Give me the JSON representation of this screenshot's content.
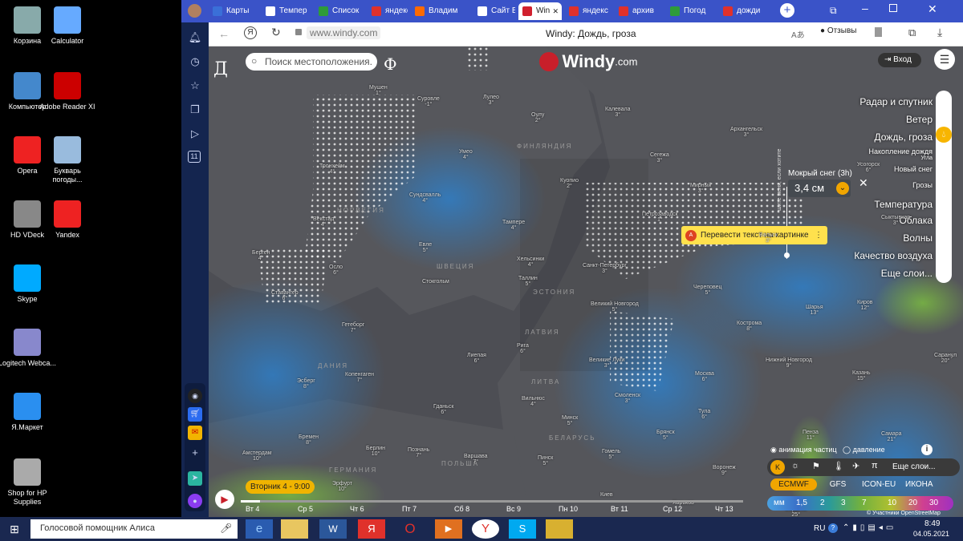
{
  "desktop": {
    "icons": [
      {
        "label": "Корзина",
        "icon": "recycle-bin-icon"
      },
      {
        "label": "Calculator",
        "icon": "calculator-icon"
      },
      {
        "label": "Компьютер",
        "icon": "computer-icon"
      },
      {
        "label": "Adobe Reader XI",
        "icon": "adobe-reader-icon"
      },
      {
        "label": "Opera",
        "icon": "opera-icon"
      },
      {
        "label": "Букварь погоды...",
        "icon": "document-icon"
      },
      {
        "label": "HD VDeck",
        "icon": "hd-vdeck-icon"
      },
      {
        "label": "Yandex",
        "icon": "yandex-browser-icon"
      },
      {
        "label": "Skype",
        "icon": "skype-icon"
      },
      {
        "label": "Logitech Webca...",
        "icon": "webcam-icon"
      },
      {
        "label": "Я.Маркет",
        "icon": "yandex-market-icon"
      },
      {
        "label": "Shop for HP Supplies",
        "icon": "hp-printer-icon"
      }
    ]
  },
  "tabs": [
    {
      "label": "Карты",
      "color": "#3a6fd8"
    },
    {
      "label": "Темпер",
      "color": "#ffffff"
    },
    {
      "label": "Список",
      "color": "#2e9b3a"
    },
    {
      "label": "яндекс",
      "color": "#e0312b"
    },
    {
      "label": "Владим",
      "color": "#ff6a00"
    },
    {
      "label": "Сайт В",
      "color": "#ffffff"
    },
    {
      "label": "Win",
      "color": "#d0202e",
      "active": true
    },
    {
      "label": "яндекс",
      "color": "#e0312b"
    },
    {
      "label": "архив",
      "color": "#e0312b"
    },
    {
      "label": "Погод",
      "color": "#2e9b3a"
    },
    {
      "label": "дожди",
      "color": "#e0312b"
    }
  ],
  "address": {
    "url": "www.windy.com",
    "title": "Windy: Дождь, гроза",
    "reviews": "Отзывы"
  },
  "windy": {
    "search_placeholder": "Поиск местоположения.",
    "logo_main": "Windy",
    "logo_domain": ".com",
    "login": "Вход",
    "letter_left": "Д",
    "letter_right": "Ф",
    "popup_title": "Мокрый снег (3h)",
    "popup_value": "3,4 см",
    "vertical_text": "шите меня, если хотите",
    "translate_text": "Перевести текст на картинке",
    "layers": [
      "Радар и спутник",
      "Ветер",
      "Дождь, гроза",
      "Накопление дождя",
      "Угла",
      "Новый снег",
      "Грозы",
      "Температура",
      "Облака",
      "Волны",
      "Качество воздуха",
      "Еще слои..."
    ],
    "time_label": "Вторник 4 - 9:00",
    "days": [
      "Вт 4",
      "Ср 5",
      "Чт 6",
      "Пт 7",
      "Сб 8",
      "Вс 9",
      "Пн 10",
      "Вт 11",
      "Ср 12",
      "Чт 13"
    ],
    "particles": "анимация частиц",
    "pressure": "давление",
    "more_layers": "Еще слои...",
    "models": [
      "ECMWF",
      "GFS",
      "ICON-EU",
      "ИКОНА"
    ],
    "scale_unit": "мм",
    "scale": [
      "1,5",
      "2",
      "3",
      "7",
      "10",
      "20",
      "30"
    ],
    "attribution": "© Участники OpenStreetMap"
  },
  "map_labels": {
    "cities": [
      {
        "t": "Мушен",
        "d": "1°"
      },
      {
        "t": "Суровле",
        "d": "-1°"
      },
      {
        "t": "Лулео",
        "d": "3°"
      },
      {
        "t": "Калевала",
        "d": "3°"
      },
      {
        "t": "Оулу",
        "d": "2°"
      },
      {
        "t": "Архангельск",
        "d": "3°"
      },
      {
        "t": "Умео",
        "d": "4°"
      },
      {
        "t": "Сегежа",
        "d": "3°"
      },
      {
        "t": "Усогорск",
        "d": "6°"
      },
      {
        "t": "Тронхейм",
        "d": "4°"
      },
      {
        "t": "Куопио",
        "d": "2°"
      },
      {
        "t": "Мирный",
        "d": "3°"
      },
      {
        "t": "Сундсвалль",
        "d": "4°"
      },
      {
        "t": "Петрозаводск",
        "d": "1°"
      },
      {
        "t": "Сыктывкар",
        "d": "3°"
      },
      {
        "t": "Векстад",
        "d": "4°"
      },
      {
        "t": "Тампере",
        "d": "4°"
      },
      {
        "t": "Вальск",
        "d": "3°"
      },
      {
        "t": "Берген",
        "d": "4°"
      },
      {
        "t": "Евле",
        "d": "5°"
      },
      {
        "t": "Хельсинки",
        "d": "4°"
      },
      {
        "t": "Санкт-Петербург",
        "d": "3°"
      },
      {
        "t": "Осло",
        "d": "6°"
      },
      {
        "t": "Стокгольм",
        "d": ""
      },
      {
        "t": "Таллин",
        "d": "5°"
      },
      {
        "t": "Череповец",
        "d": "5°"
      },
      {
        "t": "Ставангер",
        "d": "6°"
      },
      {
        "t": "Великий Новгород",
        "d": "5°"
      },
      {
        "t": "Шарья",
        "d": "13°"
      },
      {
        "t": "Киров",
        "d": "12°"
      },
      {
        "t": "Гетеборг",
        "d": "7°"
      },
      {
        "t": "Кострома",
        "d": "8°"
      },
      {
        "t": "Рига",
        "d": "6°"
      },
      {
        "t": "Лиепая",
        "d": "6°"
      },
      {
        "t": "Великие Луки",
        "d": "3°"
      },
      {
        "t": "Нижний Новгород",
        "d": "9°"
      },
      {
        "t": "Саранул",
        "d": "20°"
      },
      {
        "t": "Эсберг",
        "d": "8°"
      },
      {
        "t": "Копенгаген",
        "d": "7°"
      },
      {
        "t": "Москва",
        "d": "6°"
      },
      {
        "t": "Казань",
        "d": "15°"
      },
      {
        "t": "Вильнюс",
        "d": "4°"
      },
      {
        "t": "Гданьск",
        "d": "6°"
      },
      {
        "t": "Смоленск",
        "d": "3°"
      },
      {
        "t": "Тула",
        "d": "6°"
      },
      {
        "t": "Минск",
        "d": "5°"
      },
      {
        "t": "Бремен",
        "d": "8°"
      },
      {
        "t": "Брянск",
        "d": "5°"
      },
      {
        "t": "Пенза",
        "d": "11°"
      },
      {
        "t": "Самара",
        "d": "21°"
      },
      {
        "t": "Амстердам",
        "d": "10°"
      },
      {
        "t": "Берлин",
        "d": "10°"
      },
      {
        "t": "Познань",
        "d": "7°"
      },
      {
        "t": "Варшава",
        "d": "7°"
      },
      {
        "t": "Пинск",
        "d": "5°"
      },
      {
        "t": "Гомель",
        "d": "5°"
      },
      {
        "t": "Воронеж",
        "d": "9°"
      },
      {
        "t": "Эрфурт",
        "d": "10°"
      },
      {
        "t": "Киев",
        "d": ""
      },
      {
        "t": "Харьков",
        "d": ""
      },
      {
        "t": "Саратов",
        "d": "25°"
      }
    ],
    "countries": [
      "ФИНЛЯНДИЯ",
      "ШВЕЦИЯ",
      "НОРВЕГИЯ",
      "ЭСТОНИЯ",
      "ЛАТВИЯ",
      "ЛИТВА",
      "БЕЛАРУСЬ",
      "ПОЛЬША",
      "ГЕРМАНИЯ",
      "ДАНИЯ"
    ]
  },
  "taskbar": {
    "alice": "Голосовой помощник Алиса",
    "lang": "RU",
    "time": "8:49",
    "date": "04.05.2021"
  }
}
